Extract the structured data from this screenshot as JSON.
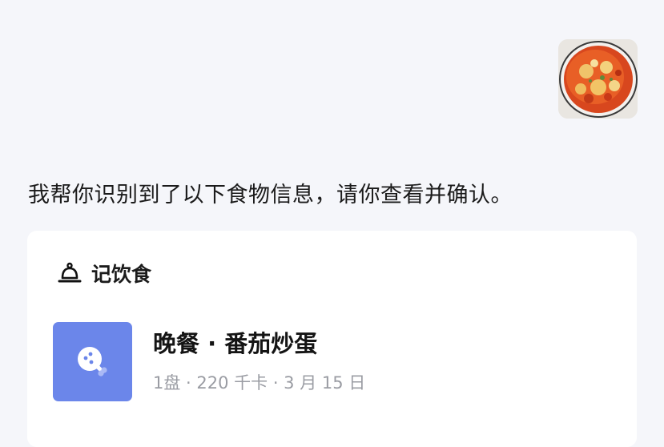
{
  "chat": {
    "user_image_icon": "tomato-egg-dish-photo",
    "assistant_message": "我帮你识别到了以下食物信息，请你查看并确认。"
  },
  "card": {
    "header_icon": "bell-icon",
    "title": "记饮食",
    "meal": {
      "icon": "food-item-icon",
      "icon_background": "#6b86ea",
      "title": "晚餐 · 番茄炒蛋",
      "meta": "1盘 · 220 千卡 · 3 月 15 日"
    }
  },
  "colors": {
    "page_background": "#f5f6fa",
    "card_background": "#ffffff",
    "meta_text": "#9a9ca3"
  }
}
